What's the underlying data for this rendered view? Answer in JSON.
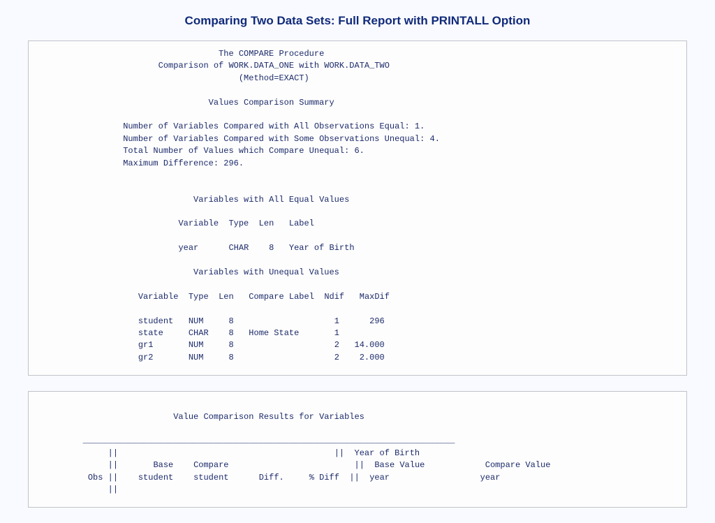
{
  "title": "Comparing Two Data Sets: Full Report with PRINTALL Option",
  "report1": {
    "h1": "The COMPARE Procedure",
    "h2": "Comparison of WORK.DATA_ONE with WORK.DATA_TWO",
    "h3": "(Method=EXACT)",
    "summaryTitle": "Values Comparison Summary",
    "s1": "Number of Variables Compared with All Observations Equal: 1.",
    "s2": "Number of Variables Compared with Some Observations Unequal: 4.",
    "s3": "Total Number of Values which Compare Unequal: 6.",
    "s4": "Maximum Difference: 296.",
    "equalTitle": "Variables with All Equal Values",
    "equalHeader": {
      "c1": "Variable",
      "c2": "Type",
      "c3": "Len",
      "c4": "Label"
    },
    "equalRow": {
      "c1": "year",
      "c2": "CHAR",
      "c3": "8",
      "c4": "Year of Birth"
    },
    "unequalTitle": "Variables with Unequal Values",
    "unequalHeader": {
      "c1": "Variable",
      "c2": "Type",
      "c3": "Len",
      "c4": "Compare",
      "c5": "Label",
      "c6": "Ndif",
      "c7": "MaxDif"
    },
    "u1": {
      "c1": "student",
      "c2": "NUM",
      "c3": "8",
      "c4": "",
      "c5": "",
      "c6": "1",
      "c7": "296"
    },
    "u2": {
      "c1": "state",
      "c2": "CHAR",
      "c3": "8",
      "c4": "",
      "c5": "Home State",
      "c6": "1",
      "c7": ""
    },
    "u3": {
      "c1": "gr1",
      "c2": "NUM",
      "c3": "8",
      "c4": "",
      "c5": "",
      "c6": "2",
      "c7": "14.000"
    },
    "u4": {
      "c1": "gr2",
      "c2": "NUM",
      "c3": "8",
      "c4": "",
      "c5": "",
      "c6": "2",
      "c7": "2.000"
    }
  },
  "report2": {
    "title": "Value Comparison Results for Variables",
    "rule": "__________________________________________________________________________",
    "head1": {
      "obs": "",
      "sep": "||",
      "b1": "",
      "b2": "",
      "b3": "",
      "b4": "",
      "sep2": "||",
      "yob": "Year of Birth"
    },
    "head2": {
      "obs": "",
      "sep": "||",
      "b1": "Base",
      "b2": "Compare",
      "b3": "",
      "b4": "",
      "sep2": "||",
      "yob1": "Base Value",
      "yob2": "Compare Value"
    },
    "head3": {
      "obs": "Obs",
      "sep": "||",
      "b1": "student",
      "b2": "student",
      "b3": "Diff.",
      "b4": "% Diff",
      "sep2": "||",
      "yob1": "year",
      "yob2": "year"
    },
    "head4": {
      "obs": "",
      "sep": "||"
    }
  }
}
